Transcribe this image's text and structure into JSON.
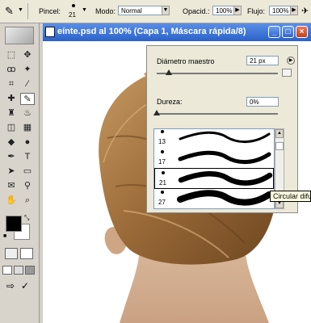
{
  "options_bar": {
    "brush_label": "Pincel:",
    "brush_size": "21",
    "mode_label": "Modo:",
    "mode_value": "Normal",
    "opacity_label": "Opacid.:",
    "opacity_value": "100%",
    "flow_label": "Flujo:",
    "flow_value": "100%"
  },
  "document": {
    "title": "eínte.psd al 100% (Capa 1, Máscara rápida/8)",
    "titlebar_color": "#2a62c9"
  },
  "brush_panel": {
    "master_diameter_label": "Diámetro maestro",
    "master_diameter_value": "21 px",
    "master_diameter_fraction": 0.1,
    "hardness_label": "Dureza:",
    "hardness_value": "0%",
    "hardness_fraction": 0.0,
    "presets": [
      {
        "size": "13"
      },
      {
        "size": "17"
      },
      {
        "size": "21"
      },
      {
        "size": "27"
      }
    ],
    "selected_preset_index": 2,
    "tooltip": "Circular difuso"
  },
  "toolbox": {
    "tools": [
      "marquee-icon",
      "move-icon",
      "lasso-icon",
      "magic-wand-icon",
      "crop-icon",
      "slice-icon",
      "healing-brush-icon",
      "brush-icon",
      "clone-stamp-icon",
      "history-brush-icon",
      "eraser-icon",
      "gradient-icon",
      "blur-icon",
      "dodge-icon",
      "pen-icon",
      "type-icon",
      "path-selection-icon",
      "shape-icon",
      "notes-icon",
      "eyedropper-icon",
      "hand-icon",
      "zoom-icon"
    ],
    "foreground_color": "#000000",
    "background_color": "#ffffff"
  }
}
